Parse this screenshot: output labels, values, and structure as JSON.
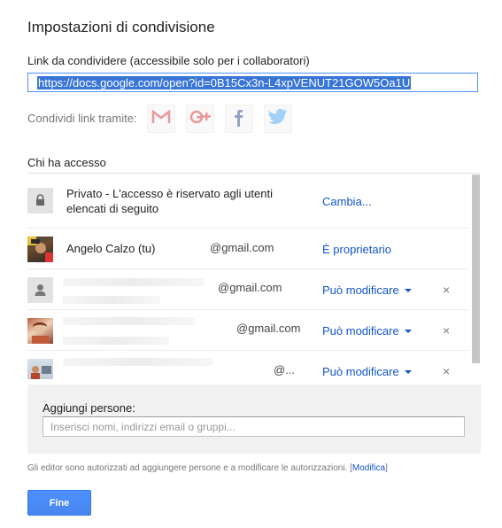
{
  "dialog": {
    "title": "Impostazioni di condivisione",
    "link_label": "Link da condividere (accessibile solo per i collaboratori)",
    "link_url": "https://docs.google.com/open?id=0B15Cx3n-L4xpVENUT21GOW5Oa1U",
    "share_via_label": "Condividi link tramite:",
    "share_services": [
      "gmail-icon",
      "google-plus-icon",
      "facebook-icon",
      "twitter-icon"
    ],
    "access_label": "Chi ha accesso",
    "rows": [
      {
        "name": "Privato - L'accesso è riservato agli utenti elencati di seguito",
        "email": "",
        "role": "Cambia..."
      },
      {
        "name": "Angelo Calzo (tu)",
        "email": "@gmail.com",
        "role": "È proprietario"
      },
      {
        "name": "",
        "email": "@gmail.com",
        "role": "Può modificare",
        "remove": "×"
      },
      {
        "name": "",
        "email": "@gmail.com",
        "role": "Può modificare",
        "remove": "×"
      },
      {
        "name": "",
        "email": "@...",
        "role": "Può modificare",
        "remove": "×"
      }
    ],
    "add_people_label": "Aggiungi persone:",
    "add_people_placeholder": "Inserisci nomi, indirizzi email o gruppi...",
    "footnote_text": "Gli editor sono autorizzati ad aggiungere persone e a modificare le autorizzazioni. [",
    "footnote_link": "Modifica",
    "footnote_end": "]",
    "done_label": "Fine"
  },
  "colors": {
    "link_blue": "#1155cc",
    "selection_blue": "#3875d7",
    "button_blue": "#4d90fe"
  }
}
